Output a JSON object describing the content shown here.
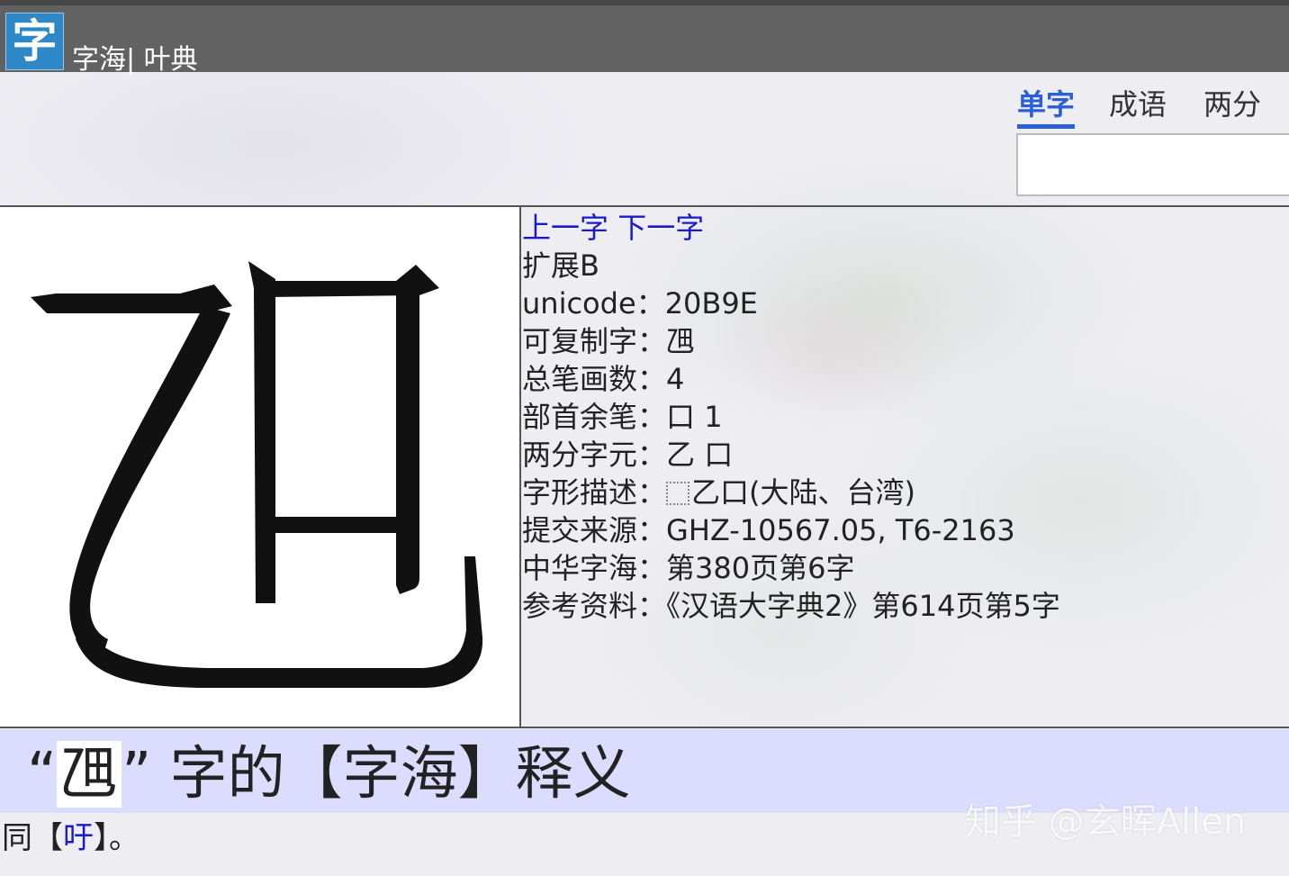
{
  "header": {
    "logo_char": "字",
    "site_name": "字海| 叶典"
  },
  "nav": {
    "tabs": [
      {
        "label": "单字",
        "active": true
      },
      {
        "label": "成语",
        "active": false
      },
      {
        "label": "两分",
        "active": false
      }
    ],
    "search_value": ""
  },
  "character": {
    "glyph": "乪",
    "prev_link": "上一字",
    "next_link": "下一字",
    "block": "扩展B",
    "unicode_label": "unicode：",
    "unicode_value": "20B9E",
    "copyable_label": "可复制字：",
    "copyable_value": "乪",
    "strokes_label": "总笔画数：",
    "strokes_value": "4",
    "radical_label": "部首余笔：",
    "radical_value": "口 1",
    "components_label": "两分字元：",
    "components_value": "乙 口",
    "ids_label": "字形描述：",
    "ids_value": "乙口(大陆、台湾)",
    "source_label": "提交来源：",
    "source_value": "GHZ-10567.05, T6-2163",
    "zhonghua_label": "中华字海：",
    "zhonghua_value": "第380页第6字",
    "reference_label": "参考资料：",
    "reference_value": "《汉语大字典2》第614页第5字"
  },
  "definition": {
    "heading_open": "“",
    "heading_char": "乪",
    "heading_close": "”",
    "heading_rest": " 字的【字海】释义",
    "prefix": "同【",
    "link": "吁",
    "suffix": "】。"
  },
  "watermark": "知乎 @玄晖Allen"
}
